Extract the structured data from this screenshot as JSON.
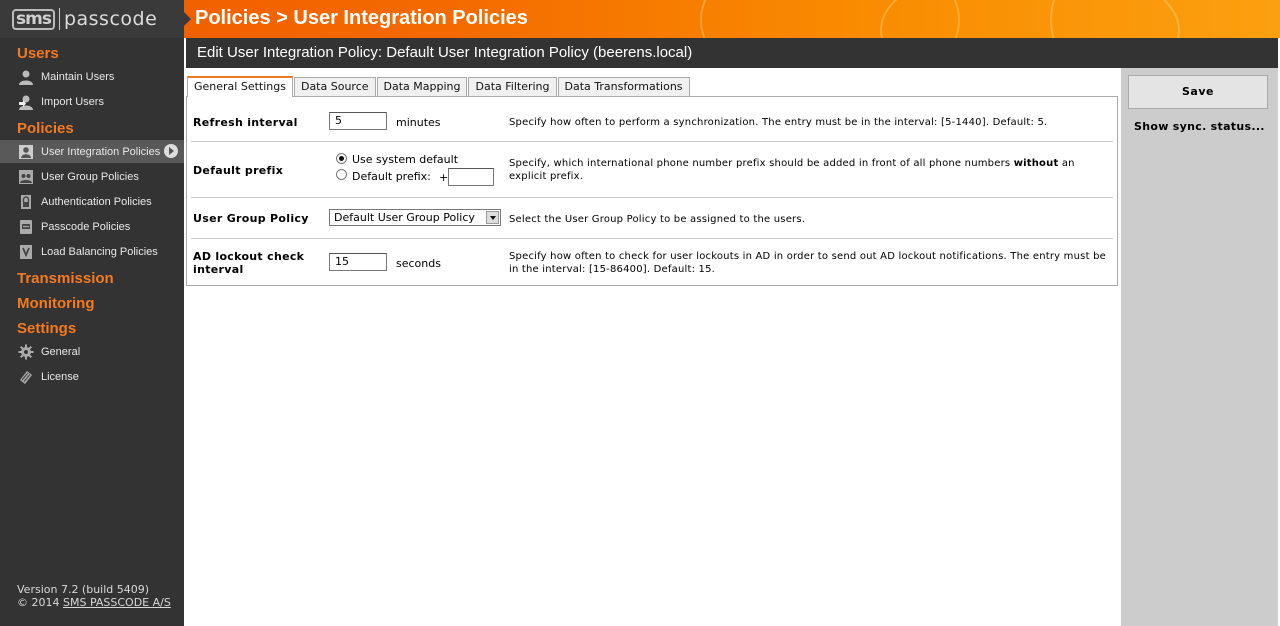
{
  "header": {
    "logo_sms": "sms",
    "logo_text": "passcode",
    "title": "Policies > User Integration Policies"
  },
  "sidebar": {
    "sections": [
      {
        "heading": "Users",
        "items": [
          {
            "label": "Maintain Users",
            "icon": "user-icon"
          },
          {
            "label": "Import Users",
            "icon": "user-import-icon"
          }
        ]
      },
      {
        "heading": "Policies",
        "items": [
          {
            "label": "User Integration Policies",
            "icon": "user-integration-icon",
            "active": true
          },
          {
            "label": "User Group Policies",
            "icon": "user-group-icon"
          },
          {
            "label": "Authentication Policies",
            "icon": "lock-icon"
          },
          {
            "label": "Passcode Policies",
            "icon": "passcode-icon"
          },
          {
            "label": "Load Balancing Policies",
            "icon": "balance-icon"
          }
        ]
      },
      {
        "heading": "Transmission",
        "items": []
      },
      {
        "heading": "Monitoring",
        "items": []
      },
      {
        "heading": "Settings",
        "items": [
          {
            "label": "General",
            "icon": "gear-icon"
          },
          {
            "label": "License",
            "icon": "license-icon"
          }
        ]
      }
    ],
    "version_line": "Version 7.2 (build 5409)",
    "copyright_prefix": "© 2014",
    "copyright_link": "SMS PASSCODE A/S"
  },
  "subheader": {
    "title": "Edit User Integration Policy: Default User Integration Policy (beerens.local)"
  },
  "tabs": [
    {
      "label": "General Settings",
      "active": true
    },
    {
      "label": "Data Source"
    },
    {
      "label": "Data Mapping"
    },
    {
      "label": "Data Filtering"
    },
    {
      "label": "Data Transformations"
    }
  ],
  "form": {
    "refresh": {
      "label": "Refresh interval",
      "value": "5",
      "unit": "minutes",
      "description": "Specify how often to perform a synchronization. The entry must be in the interval: [5-1440]. Default: 5."
    },
    "prefix": {
      "label": "Default prefix",
      "option_system": "Use system default",
      "option_custom": "Default prefix:",
      "plus": "+",
      "custom_value": "",
      "selected": "system",
      "description_a": "Specify, which international phone number prefix should be added in front of all phone numbers",
      "description_bold": "without",
      "description_b": "an explicit prefix."
    },
    "group_policy": {
      "label": "User Group Policy",
      "selected": "Default User Group Policy",
      "description": "Select the User Group Policy to be assigned to the users."
    },
    "lockout": {
      "label": "AD lockout check interval",
      "value": "15",
      "unit": "seconds",
      "description": "Specify how often to check for user lockouts in AD in order to send out AD lockout notifications. The entry must be in the interval: [15-86400]. Default: 15."
    }
  },
  "actions": {
    "save_label": "Save",
    "sync_label": "Show sync. status..."
  },
  "colors": {
    "accent_orange": "#f57a1f",
    "sidebar_bg": "#333333",
    "action_panel_bg": "#cccccc"
  }
}
